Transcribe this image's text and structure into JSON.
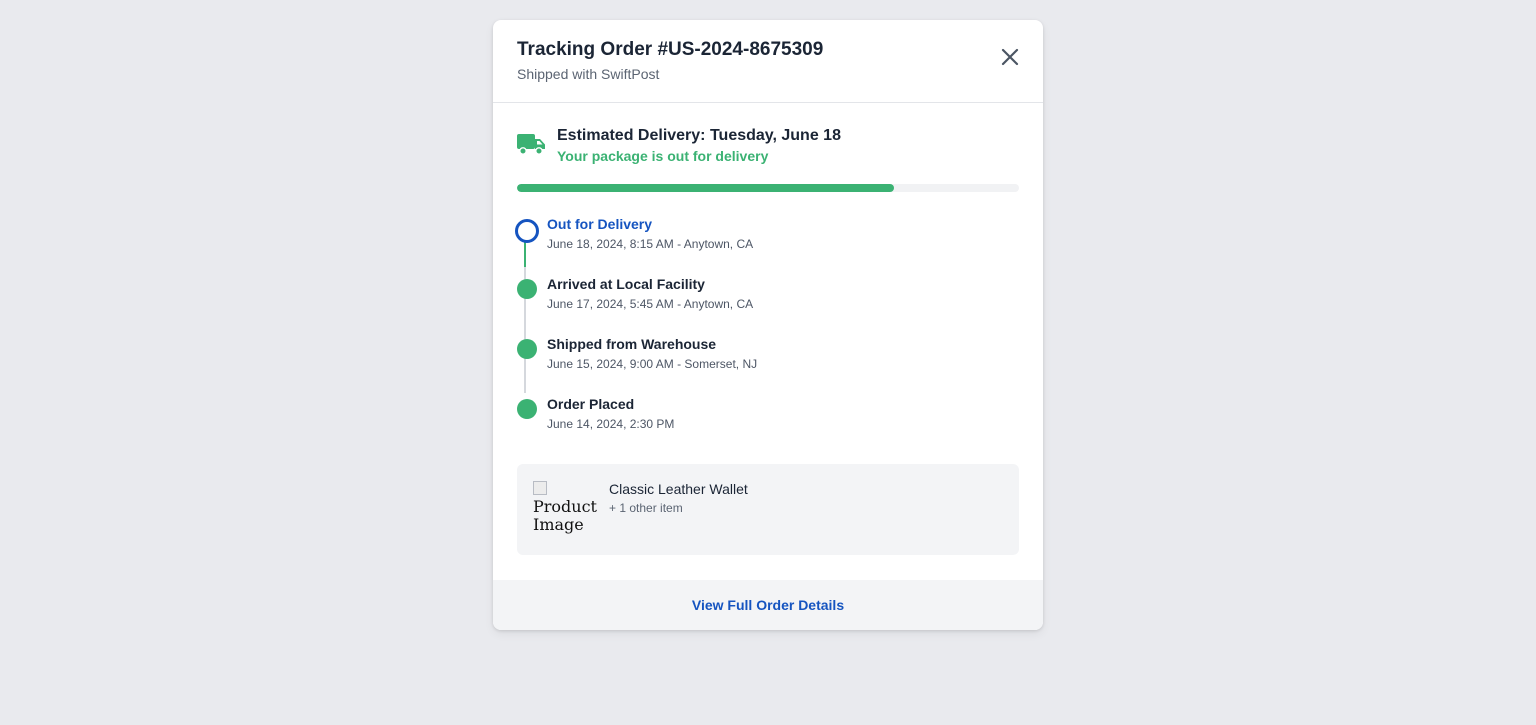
{
  "header": {
    "title": "Tracking Order #US-2024-8675309",
    "subtitle": "Shipped with SwiftPost",
    "close_icon": "close-icon"
  },
  "delivery": {
    "icon": "truck-icon",
    "estimated_label": "Estimated Delivery: Tuesday, June 18",
    "status": "Your package is out for delivery",
    "progress_percent": 75
  },
  "timeline": [
    {
      "label": "Out for Delivery",
      "detail": "June 18, 2024, 8:15 AM - Anytown, CA",
      "state": "current"
    },
    {
      "label": "Arrived at Local Facility",
      "detail": "June 17, 2024, 5:45 AM - Anytown, CA",
      "state": "done"
    },
    {
      "label": "Shipped from Warehouse",
      "detail": "June 15, 2024, 9:00 AM - Somerset, NJ",
      "state": "done"
    },
    {
      "label": "Order Placed",
      "detail": "June 14, 2024, 2:30 PM",
      "state": "done"
    }
  ],
  "product": {
    "image_alt": "Product Image",
    "name": "Classic Leather Wallet",
    "more_items": "+ 1 other item"
  },
  "footer": {
    "link_label": "View Full Order Details"
  },
  "colors": {
    "accent_green": "#3bb273",
    "accent_blue": "#1554c0",
    "text_dark": "#1b2535",
    "page_bg": "#e9eaee"
  }
}
